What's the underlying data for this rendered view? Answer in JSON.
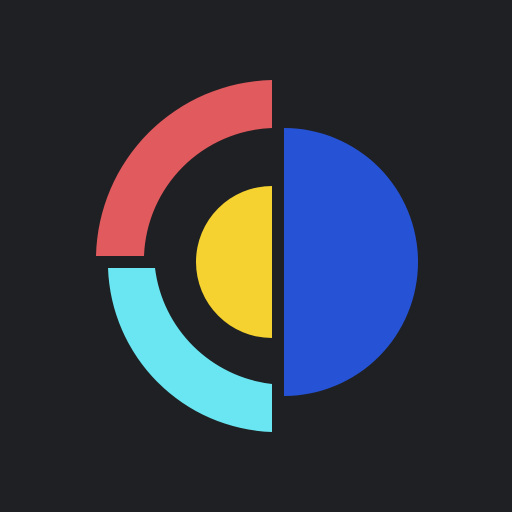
{
  "logo": {
    "colors": {
      "background": "#1f2023",
      "top_left_arc": "#e05a5e",
      "bottom_left_arc": "#69e6f1",
      "center_half_circle": "#f5d22f",
      "right_half_circle": "#2653d6"
    }
  }
}
